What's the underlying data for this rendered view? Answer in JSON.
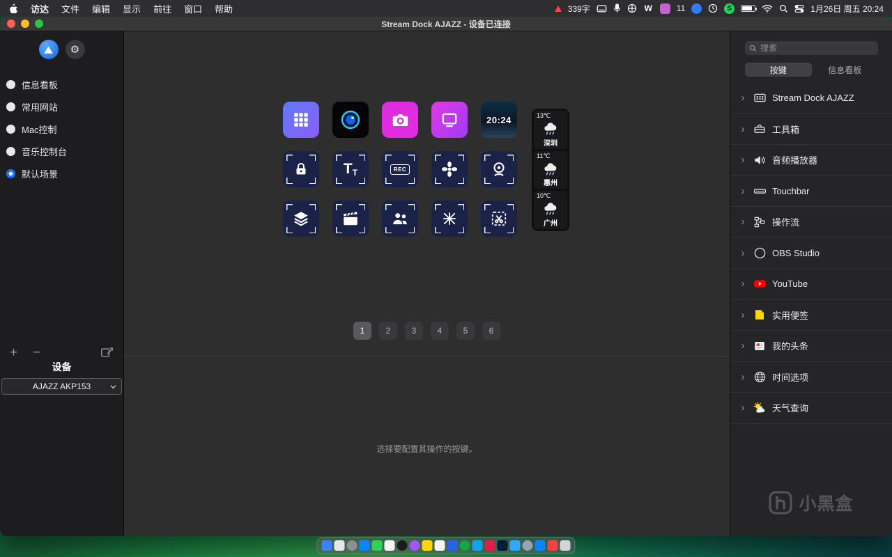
{
  "colors": {
    "accent_blue": "#1f6ff5",
    "key_magenta": "#df2ce0",
    "key_navy": "#1a2347",
    "youtube_red": "#ff0000",
    "note_yellow": "#ffd60a",
    "spotify_green": "#1ed760",
    "traffic_red": "#ff5f57",
    "traffic_yellow": "#febc2e",
    "traffic_green": "#28c840"
  },
  "icons": {
    "chevron": "›",
    "gear": "⚙",
    "plus": "+",
    "minus": "−",
    "wiki": "W",
    "spotify": "S"
  },
  "menu_bar": {
    "items": [
      "访达",
      "文件",
      "编辑",
      "显示",
      "前往",
      "窗口",
      "帮助"
    ],
    "word_count": "339字",
    "badge_count": "11",
    "datetime": "1月26日 周五 20:24"
  },
  "window_title": "Stream Dock AJAZZ - 设备已连接",
  "sidebar": {
    "items": [
      {
        "label": "信息看板"
      },
      {
        "label": "常用网站"
      },
      {
        "label": "Mac控制"
      },
      {
        "label": "音乐控制台"
      },
      {
        "label": "默认场景"
      }
    ],
    "device_header": "设备",
    "device_value": "AJAZZ AKP153"
  },
  "keys": {
    "clock_text": "20:24",
    "tt_big": "T",
    "tt_small": "T",
    "rec_label": "REC"
  },
  "weather": [
    {
      "temp": "13℃",
      "city": "深圳"
    },
    {
      "temp": "11℃",
      "city": "惠州"
    },
    {
      "temp": "10℃",
      "city": "广州"
    }
  ],
  "pagination": {
    "pages": [
      "1",
      "2",
      "3",
      "4",
      "5",
      "6"
    ],
    "active": "1"
  },
  "hint": "选择要配置其操作的按键。",
  "panel": {
    "search_placeholder": "搜索",
    "tabs": [
      {
        "label": "按键"
      },
      {
        "label": "信息看板"
      }
    ],
    "items": [
      {
        "label": "Stream Dock AJAZZ"
      },
      {
        "label": "工具箱"
      },
      {
        "label": "音频播放器"
      },
      {
        "label": "Touchbar"
      },
      {
        "label": "操作流"
      },
      {
        "label": "OBS Studio"
      },
      {
        "label": "YouTube"
      },
      {
        "label": "实用便签"
      },
      {
        "label": "我的头条"
      },
      {
        "label": "时间选项"
      },
      {
        "label": "天气查询"
      }
    ],
    "watermark": "小黑盒"
  }
}
